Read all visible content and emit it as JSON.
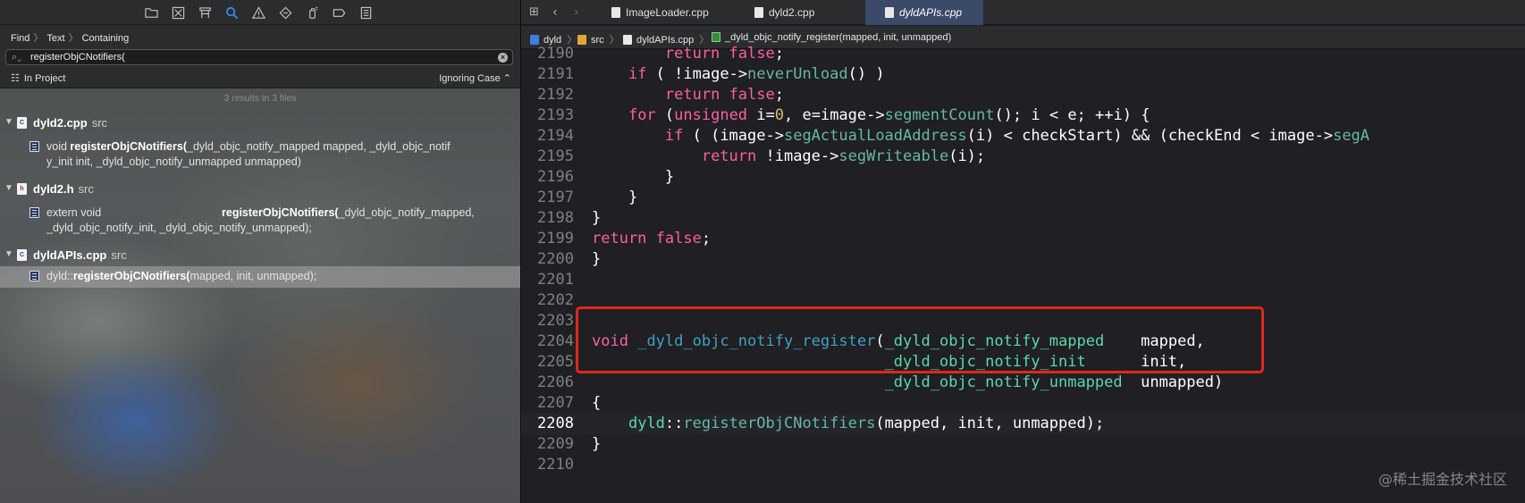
{
  "navigator": {
    "toolbar_icons": [
      "folder-icon",
      "source-control-icon",
      "hierarchy-icon",
      "search-icon",
      "warning-icon",
      "test-diamond-icon",
      "debug-spray-icon",
      "breakpoint-tag-icon",
      "report-list-icon"
    ],
    "find_path": [
      "Find",
      "Text",
      "Containing"
    ],
    "search": {
      "value": "registerObjCNotifiers("
    },
    "scope": {
      "label": "In Project",
      "case": "Ignoring Case ⌃"
    },
    "results_count": "3 results in 3 files",
    "files": [
      {
        "name": "dyld2.cpp",
        "dir": "src",
        "icon": "C",
        "match": {
          "prefix": "void ",
          "term": "registerObjCNotifiers(",
          "rest": "_dyld_objc_notify_mapped mapped, _dyld_objc_notif",
          "line2": "y_init init, _dyld_objc_notify_unmapped unmapped)"
        }
      },
      {
        "name": "dyld2.h",
        "dir": "src",
        "icon": "h",
        "match": {
          "prefix": "extern void",
          "term": "registerObjCNotifiers(",
          "rest": "_dyld_objc_notify_mapped,",
          "line2": "_dyld_objc_notify_init, _dyld_objc_notify_unmapped);"
        }
      },
      {
        "name": "dyldAPIs.cpp",
        "dir": "src",
        "icon": "C",
        "match": {
          "prefix": "dyld::",
          "term": "registerObjCNotifiers(",
          "rest": "mapped, init, unmapped);",
          "line2": ""
        }
      }
    ]
  },
  "editor": {
    "tabs": [
      "ImageLoader.cpp",
      "dyld2.cpp",
      "dyldAPIs.cpp"
    ],
    "active_tab": 2,
    "jump_bar": [
      "dyld",
      "src",
      "dyldAPIs.cpp",
      "_dyld_objc_notify_register(mapped, init, unmapped)"
    ],
    "lines": [
      {
        "n": "2190",
        "html": "<span class='kw'>        return</span> <span class='kw'>false</span>;"
      },
      {
        "n": "2191",
        "html": "    <span class='kw'>if</span> ( !image-&gt;<span class='fn'>neverUnload</span>() )"
      },
      {
        "n": "2192",
        "html": "        <span class='kw'>return</span> <span class='kw'>false</span>;"
      },
      {
        "n": "2193",
        "html": "    <span class='kw'>for</span> (<span class='kw'>unsigned</span> i=<span class='num'>0</span>, e=image-&gt;<span class='fn'>segmentCount</span>(); i &lt; e; ++i) {"
      },
      {
        "n": "2194",
        "html": "        <span class='kw'>if</span> ( (image-&gt;<span class='fn'>segActualLoadAddress</span>(i) &lt; checkStart) &amp;&amp; (checkEnd &lt; image-&gt;<span class='fn'>segA</span>"
      },
      {
        "n": "2195",
        "html": "            <span class='kw'>return</span> !image-&gt;<span class='fn'>segWriteable</span>(i);"
      },
      {
        "n": "2196",
        "html": "        }"
      },
      {
        "n": "2197",
        "html": "    }"
      },
      {
        "n": "2198",
        "html": "}"
      },
      {
        "n": "2199",
        "html": "<span class='kw'>return</span> <span class='kw'>false</span>;"
      },
      {
        "n": "2200",
        "html": "}"
      },
      {
        "n": "2201",
        "html": ""
      },
      {
        "n": "2202",
        "html": ""
      },
      {
        "n": "2203",
        "html": ""
      },
      {
        "n": "2204",
        "html": "<span class='kw'>void</span> <span class='id'>_dyld_objc_notify_register</span>(<span class='ty'>_dyld_objc_notify_mapped</span>    mapped,"
      },
      {
        "n": "2205",
        "html": "                                <span class='ty'>_dyld_objc_notify_init</span>      init,"
      },
      {
        "n": "2206",
        "html": "                                <span class='ty'>_dyld_objc_notify_unmapped</span>  unmapped)"
      },
      {
        "n": "2207",
        "html": "{"
      },
      {
        "n": "2208",
        "html": "    <span class='ty'>dyld</span>::<span class='fn'>registerObjCNotifiers</span>(mapped, init, unmapped);"
      },
      {
        "n": "2209",
        "html": "}"
      },
      {
        "n": "2210",
        "html": ""
      }
    ],
    "current_line": "2208",
    "watermark": "@稀土掘金技术社区"
  }
}
